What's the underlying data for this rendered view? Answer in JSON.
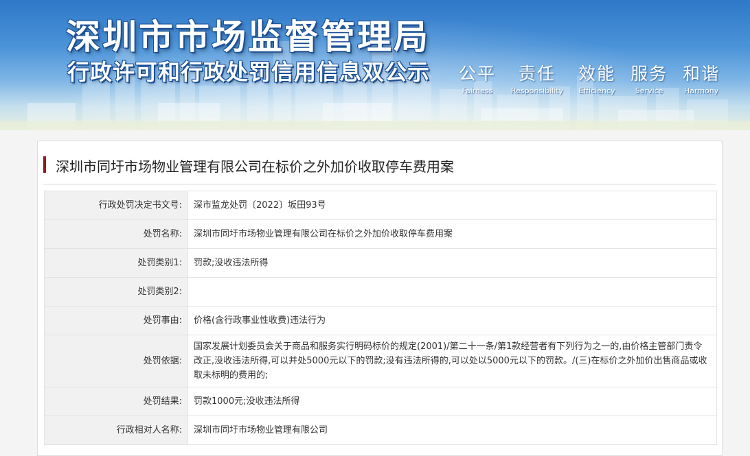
{
  "banner": {
    "title": "深圳市市场监督管理局",
    "subtitle": "行政许可和行政处罚信用信息双公示",
    "slogans": [
      {
        "cn": "公平",
        "en": "Fairness"
      },
      {
        "cn": "责任",
        "en": "Responsibility"
      },
      {
        "cn": "效能",
        "en": "Efficiency"
      },
      {
        "cn": "服务",
        "en": "Service"
      },
      {
        "cn": "和谐",
        "en": "Harmony"
      }
    ]
  },
  "case": {
    "title": "深圳市同圩市场物业管理有限公司在标价之外加价收取停车费用案"
  },
  "rows": [
    {
      "label": "行政处罚决定书文号:",
      "value": "深市监龙处罚〔2022〕坂田93号"
    },
    {
      "label": "处罚名称:",
      "value": "深圳市同圩市场物业管理有限公司在标价之外加价收取停车费用案"
    },
    {
      "label": "处罚类别1:",
      "value": "罚款;没收违法所得"
    },
    {
      "label": "处罚类别2:",
      "value": ""
    },
    {
      "label": "处罚事由:",
      "value": "价格(含行政事业性收费)违法行为"
    },
    {
      "label": "处罚依据:",
      "value": "国家发展计划委员会关于商品和服务实行明码标价的规定(2001)/第二十一条/第1款经营者有下列行为之一的,由价格主管部门责令改正,没收违法所得,可以并处5000元以下的罚款;没有违法所得的,可以处以5000元以下的罚款。/(三)在标价之外加价出售商品或收取未标明的费用的;"
    },
    {
      "label": "处罚结果:",
      "value": "罚款1000元;没收违法所得"
    },
    {
      "label": "行政相对人名称:",
      "value": "深圳市同圩市场物业管理有限公司"
    }
  ]
}
